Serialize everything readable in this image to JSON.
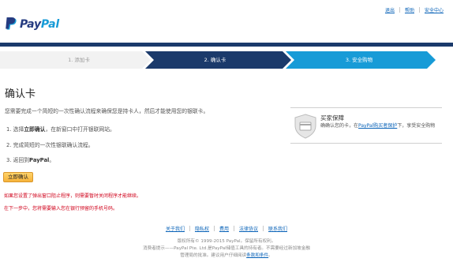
{
  "top_links": [
    "退出",
    "帮助",
    "安全中心"
  ],
  "logo": {
    "part1": "Pay",
    "part2": "Pal"
  },
  "steps": [
    {
      "label": "1. 添加卡"
    },
    {
      "label": "2. 确认卡"
    },
    {
      "label": "3. 安全购物"
    }
  ],
  "main": {
    "title": "确认卡",
    "intro": "您需要完成一个简短的一次性确认流程来确保您是持卡人，然后才能使用您的银联卡。",
    "step1_prefix": "1. 选择",
    "step1_bold": "立即确认",
    "step1_suffix": "，在新窗口中打开银联网站。",
    "step2": "2. 完成简短的一次性银联确认流程。",
    "step3_prefix": "3. 返回到",
    "step3_bold": "PayPal",
    "step3_suffix": "。",
    "confirm_button": "立即确认",
    "warning1": "如果您设置了弹出窗口阻止程序，则需要暂时关闭程序才能继续。",
    "warning2": "在下一步中，您将需要输入您在银行预留的手机号码。"
  },
  "protection": {
    "title": "买家保障",
    "desc_prefix": "确确认您的卡，在",
    "desc_link": "PayPal购买者保护",
    "desc_suffix": "下，享受安全购物"
  },
  "footer": {
    "links": [
      "关于我们",
      "隐私权",
      "费用",
      "法律协议",
      "联系我们"
    ],
    "copyright": "版权所有© 1999-2015 PayPal。保留所有权利。",
    "notice1": "消费者提示——PayPal Pte. Ltd.是PayPal储值工具的持有者。不需要经过新加坡金融",
    "notice2_prefix": "管理局的批准。建议用户仔细阅读",
    "notice2_link": "条款和条件",
    "notice2_suffix": "。"
  },
  "colors": {
    "brand_dark": "#253b80",
    "brand_light": "#179bd7",
    "topbar": "#1b3a6b",
    "step_inactive": "#f2f2f2",
    "step_active": "#1b3a6b",
    "step_next": "#179bd7",
    "button": "#f6b23a",
    "warning": "#d0021b"
  }
}
